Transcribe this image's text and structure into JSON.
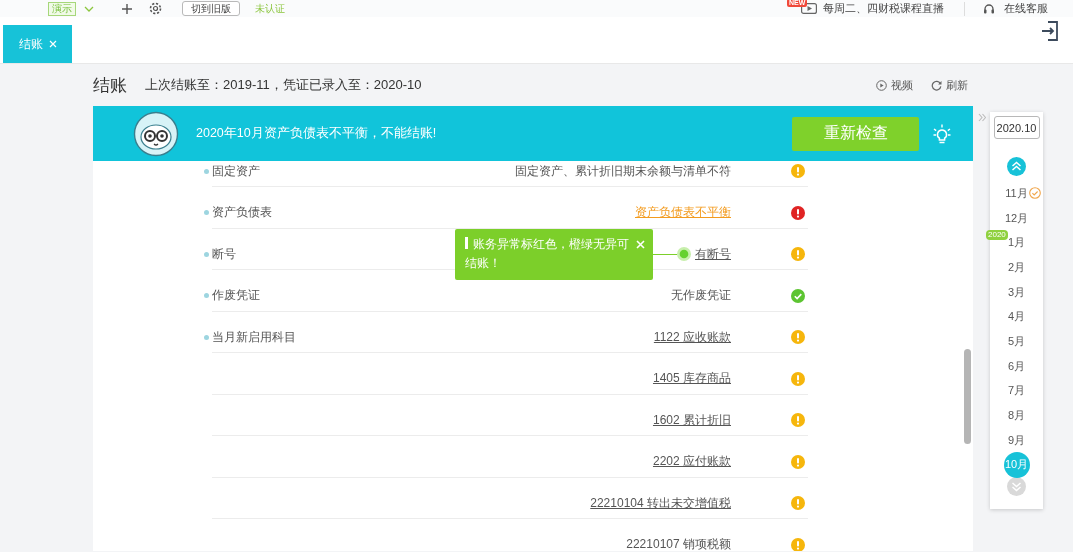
{
  "top_bar": {
    "account_tag": "演示",
    "old_version_button": "切到旧版",
    "verify_status": "未认证",
    "live_badge": "NEW",
    "live_course": "每周二、四财税课程直播",
    "support": "在线客服"
  },
  "tabs": [
    {
      "label": "结账",
      "selected": true
    }
  ],
  "page": {
    "title": "结账",
    "summary": "上次结账至：2019-11，凭证已录入至：2020-10",
    "actions": [
      {
        "kind": "video",
        "label": "视频"
      },
      {
        "kind": "refresh",
        "label": "刷新"
      }
    ]
  },
  "alert": {
    "message": "2020年10月资产负债表不平衡，不能结账!",
    "button": "重新检查"
  },
  "checks": [
    {
      "item": "固定资产",
      "result": "固定资产、累计折旧期末余额与清单不符",
      "link": false,
      "kind": "warning"
    },
    {
      "item": "资产负债表",
      "result": "资产负债表不平衡",
      "link": true,
      "kind": "error"
    },
    {
      "item": "断号",
      "result": "有断号",
      "link": true,
      "kind": "warning"
    },
    {
      "item": "作废凭证",
      "result": "无作废凭证",
      "link": false,
      "kind": "ok"
    },
    {
      "item": "当月新启用科目",
      "result": "1122 应收账款",
      "link": true,
      "kind": "warning"
    },
    {
      "result": "1405 库存商品",
      "link": true,
      "kind": "warning"
    },
    {
      "result": "1602 累计折旧",
      "link": true,
      "kind": "warning"
    },
    {
      "result": "2202 应付账款",
      "link": true,
      "kind": "warning"
    },
    {
      "result": "22210104 转出未交增值税",
      "link": true,
      "kind": "warning"
    },
    {
      "result": "22210107 销项税额",
      "link": false,
      "kind": "warning"
    }
  ],
  "tooltip": {
    "text": "账务异常标红色，橙绿无异可结账！"
  },
  "periods": {
    "current": "2020.10",
    "up_disabled": false,
    "down_disabled": true,
    "months": [
      {
        "label": "11月",
        "selected": false,
        "closed": true
      },
      {
        "label": "12月",
        "selected": false,
        "closed": false
      },
      {
        "label": "1月",
        "year": "2020",
        "selected": false,
        "closed": false
      },
      {
        "label": "2月",
        "selected": false,
        "closed": false
      },
      {
        "label": "3月",
        "selected": false,
        "closed": false
      },
      {
        "label": "4月",
        "selected": false,
        "closed": false
      },
      {
        "label": "5月",
        "selected": false,
        "closed": false
      },
      {
        "label": "6月",
        "selected": false,
        "closed": false
      },
      {
        "label": "7月",
        "selected": false,
        "closed": false
      },
      {
        "label": "8月",
        "selected": false,
        "closed": false
      },
      {
        "label": "9月",
        "selected": false,
        "closed": false
      },
      {
        "label": "10月",
        "selected": true,
        "closed": false
      }
    ]
  }
}
